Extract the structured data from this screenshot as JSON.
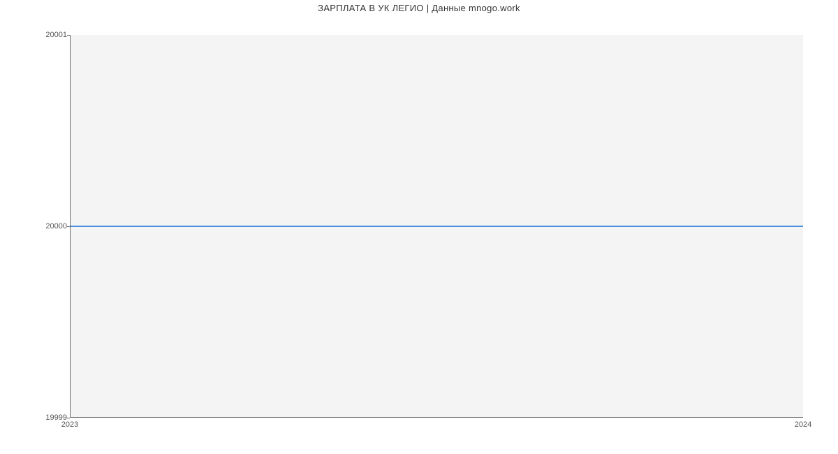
{
  "chart_data": {
    "type": "line",
    "title": "ЗАРПЛАТА В УК ЛЕГИО | Данные mnogo.work",
    "x": [
      2023,
      2024
    ],
    "values": [
      20000,
      20000
    ],
    "xlabel": "",
    "ylabel": "",
    "xlim": [
      2023,
      2024
    ],
    "ylim": [
      19999,
      20001
    ],
    "x_ticks": [
      2023,
      2024
    ],
    "y_ticks": [
      19999,
      20000,
      20001
    ],
    "series_color": "#4a90e2",
    "background": "#f4f4f4"
  }
}
